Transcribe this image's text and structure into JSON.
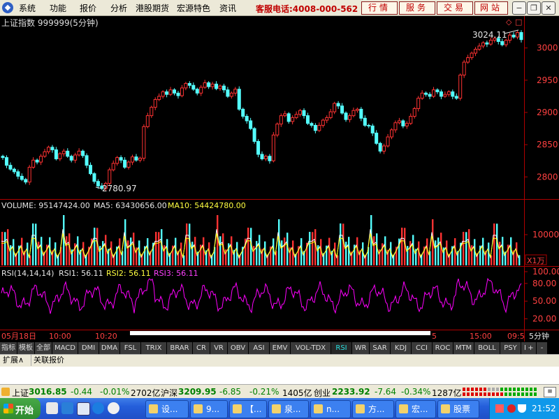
{
  "menu": {
    "items": [
      "系统",
      "功能",
      "报价",
      "分析",
      "港股期货",
      "宏源特色",
      "资讯"
    ],
    "hotline": "客服电话:4008-000-562",
    "buttons": [
      "行情",
      "服务",
      "交易",
      "网站"
    ]
  },
  "chart": {
    "title": "上证指数 999999(5分钟)",
    "price_ticks": [
      "3000",
      "2950",
      "2900",
      "2850",
      "2800"
    ],
    "high_label": "3024.11",
    "low_label": "2780.97",
    "volume_header": {
      "volume": "VOLUME: 95147424.00",
      "ma5": "MA5: 63430656.00",
      "ma10": "MA10: 54424780.00"
    },
    "volume_tick": "10000",
    "volume_unit": "X1万",
    "rsi_header": {
      "params": "RSI(14,14,14)",
      "rsi1": "RSI1: 56.11",
      "rsi2": "RSI2: 56.11",
      "rsi3": "RSI3: 56.11"
    },
    "rsi_ticks": [
      "100.00",
      "80.00",
      "50.00",
      "20.00"
    ],
    "time_labels": [
      "05月18日",
      "10:00",
      "10:20",
      "5",
      "15:00",
      "09:5"
    ],
    "period": "5分钟",
    "colors": {
      "up": "#ff3232",
      "down": "#54ffff",
      "volume_ma5": "#ffffff",
      "volume_ma10": "#ffff00",
      "rsi": "#ff00ff",
      "axis": "#b00000"
    }
  },
  "chart_data": {
    "type": "candlestick",
    "ylim": [
      2770,
      3030
    ],
    "close": [
      2830,
      2818,
      2812,
      2808,
      2801,
      2796,
      2792,
      2815,
      2826,
      2823,
      2832,
      2839,
      2846,
      2842,
      2828,
      2836,
      2840,
      2832,
      2826,
      2834,
      2840,
      2833,
      2818,
      2805,
      2793,
      2786,
      2782,
      2790,
      2811,
      2821,
      2830,
      2826,
      2815,
      2823,
      2831,
      2826,
      2829,
      2878,
      2895,
      2908,
      2920,
      2925,
      2932,
      2928,
      2935,
      2930,
      2926,
      2938,
      2945,
      2942,
      2936,
      2930,
      2939,
      2946,
      2940,
      2944,
      2937,
      2941,
      2935,
      2925,
      2930,
      2936,
      2905,
      2894,
      2887,
      2875,
      2855,
      2835,
      2828,
      2832,
      2825,
      2865,
      2882,
      2895,
      2898,
      2886,
      2892,
      2897,
      2903,
      2895,
      2883,
      2880,
      2872,
      2880,
      2888,
      2892,
      2901,
      2914,
      2910,
      2899,
      2889,
      2895,
      2903,
      2905,
      2891,
      2880,
      2879,
      2868,
      2852,
      2840,
      2848,
      2862,
      2873,
      2884,
      2887,
      2879,
      2883,
      2894,
      2906,
      2922,
      2930,
      2928,
      2925,
      2935,
      2932,
      2925,
      2928,
      2932,
      2925,
      2922,
      2958,
      2978,
      2985,
      2992,
      2998,
      3003,
      3008,
      3006,
      3012,
      3015,
      3010,
      3005,
      3012,
      3020,
      3017,
      3024,
      3013
    ]
  },
  "tabs": [
    "指标",
    "模板",
    "全部",
    "MACD",
    "DMI",
    "DMA",
    "FSL",
    "TRIX",
    "BRAR",
    "CR",
    "VR",
    "OBV",
    "ASI",
    "EMV",
    "VOL-TDX",
    "RSI",
    "WR",
    "SAR",
    "KDJ",
    "CCI",
    "ROC",
    "MTM",
    "BOLL",
    "PSY",
    "MCST"
  ],
  "tab_right": [
    "+",
    "-"
  ],
  "subtabs": [
    "扩展∧",
    "关联报价"
  ],
  "ticker": {
    "sh_name": "上证",
    "sh_value": "3016.85",
    "sh_change": "-0.44",
    "sh_pct": "-0.01%",
    "sh_amount": "2702亿",
    "sz_name": "沪深",
    "sz_value": "3209.95",
    "sz_change": "-6.85",
    "sz_pct": "-0.21%",
    "sz_amount": "1405亿",
    "cy_name": "创业",
    "cy_value": "2233.92",
    "cy_change": "-7.64",
    "cy_pct": "-0.34%",
    "cy_amount": "1287亿"
  },
  "taskbar": {
    "start": "开始",
    "buttons": [
      "设...",
      "9...",
      "【...",
      "泉...",
      "n...",
      "方...",
      "宏...",
      "股票"
    ],
    "clock": "21:52"
  }
}
